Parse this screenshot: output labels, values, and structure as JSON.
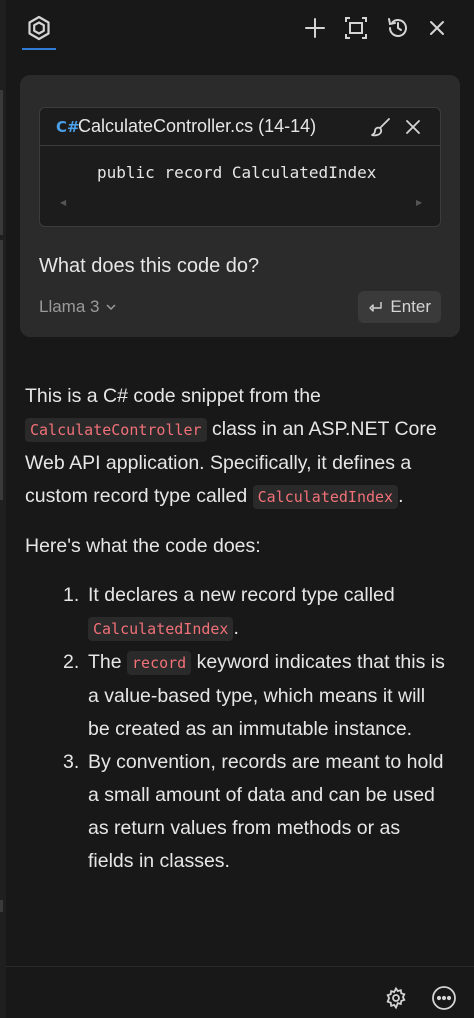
{
  "header": {
    "icons": [
      "logo-icon",
      "plus-icon",
      "maximize-icon",
      "history-icon",
      "close-icon"
    ]
  },
  "prompt": {
    "file_name": "CalculateController.cs (14-14)",
    "file_lang_icon": "C#",
    "code": "public record CalculatedIndex",
    "question": "What does this code do?",
    "model": "Llama 3",
    "enter_label": "Enter"
  },
  "response": {
    "p1_a": "This is a C# code snippet from the",
    "p1_code1": "CalculateController",
    "p1_b": " class in an ASP.NET Core Web API application. Specifically, it defines a custom record type called ",
    "p1_code2": "CalculatedIndex",
    "p1_c": ".",
    "p2": "Here's what the code does:",
    "items": [
      {
        "num": "1.",
        "a": "It declares a new record type called ",
        "code": "CalculatedIndex",
        "b": "."
      },
      {
        "num": "2.",
        "a": "The ",
        "code": "record",
        "b": " keyword indicates that this is a value-based type, which means it will be created as an immutable instance."
      },
      {
        "num": "3.",
        "a": "By convention, records are meant to hold a small amount of data and can be used as return values from methods or as fields in classes.",
        "code": "",
        "b": ""
      }
    ]
  },
  "footer": {
    "icons": [
      "settings-icon",
      "more-icon"
    ]
  }
}
